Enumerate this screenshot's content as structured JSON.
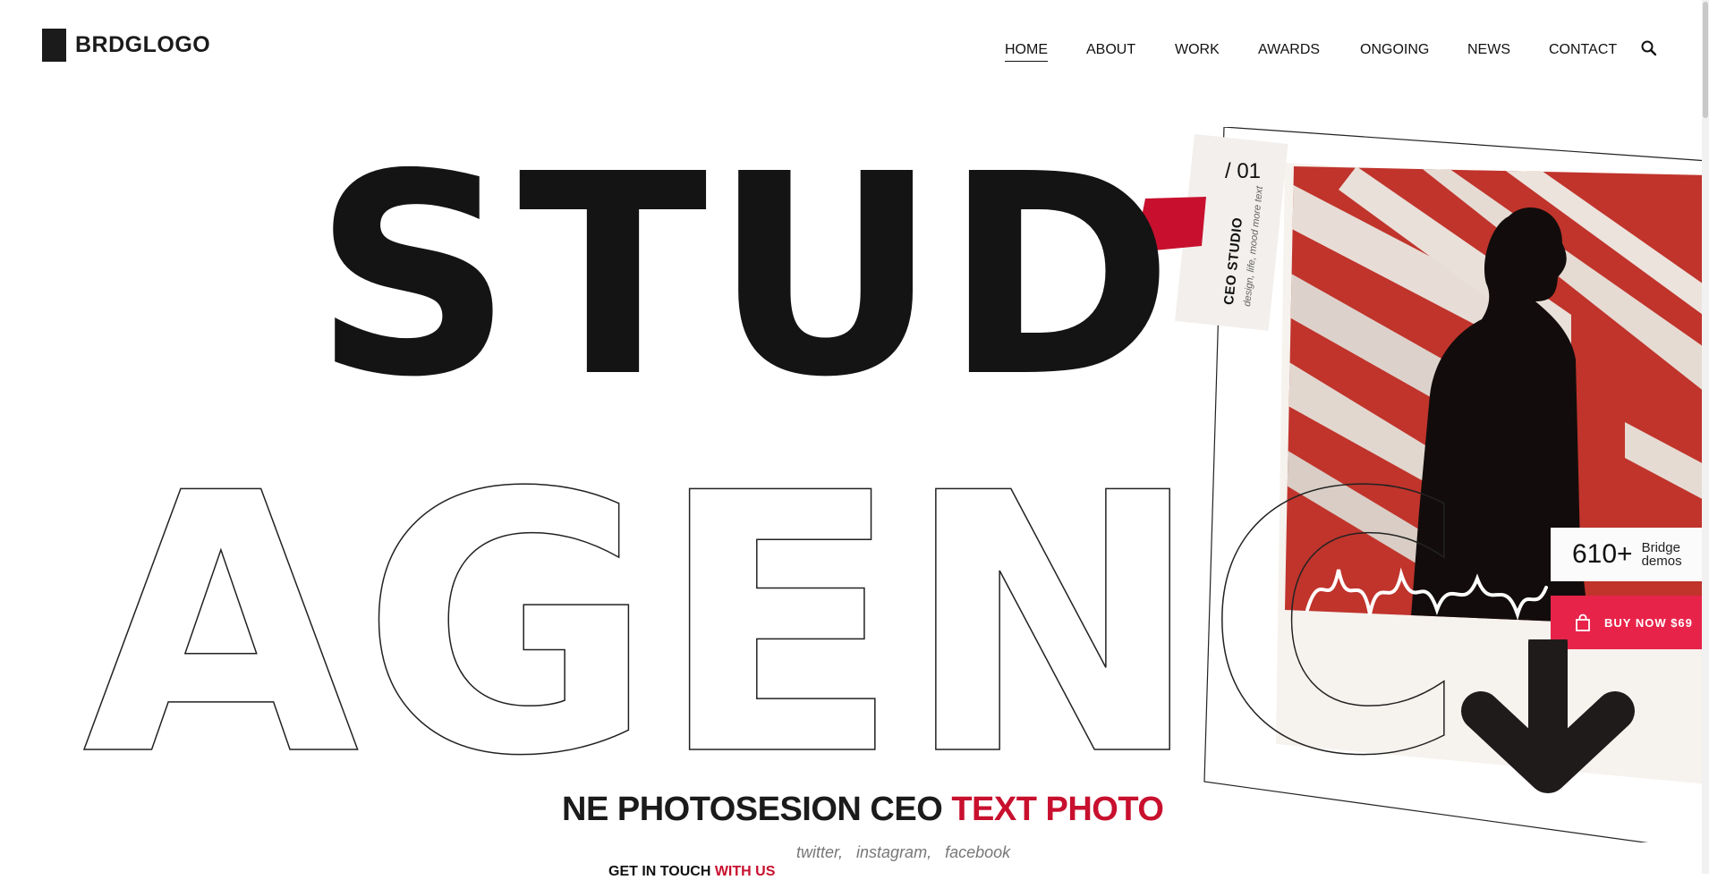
{
  "header": {
    "logo_text": "BRDGLOGO",
    "nav": [
      {
        "label": "HOME",
        "active": true
      },
      {
        "label": "ABOUT",
        "active": false
      },
      {
        "label": "WORK",
        "active": false
      },
      {
        "label": "AWARDS",
        "active": false
      },
      {
        "label": "ONGOING",
        "active": false
      },
      {
        "label": "NEWS",
        "active": false
      },
      {
        "label": "CONTACT",
        "active": false
      }
    ],
    "search_icon": "search-icon"
  },
  "hero": {
    "title_solid": "STUD",
    "title_outline": "AGENC",
    "tag_number": "/ 01",
    "tag_title": "CEO STUDIO",
    "tag_subtitle": "design, life, mood more text",
    "stat_number": "610+",
    "stat_label_line1": "Bridge",
    "stat_label_line2": "demos",
    "buy_label": "BUY NOW $69",
    "subtitle_dark": "NE PHOTOSESION CEO",
    "subtitle_accent": "TEXT PHOTO",
    "socials": [
      "twitter,",
      "instagram,",
      "facebook"
    ],
    "get_in_touch_dark": "GET IN TOUCH",
    "get_in_touch_accent": "WITH US"
  },
  "colors": {
    "accent_red": "#c8102e",
    "buy_button": "#e8234a",
    "text_dark": "#141414"
  }
}
